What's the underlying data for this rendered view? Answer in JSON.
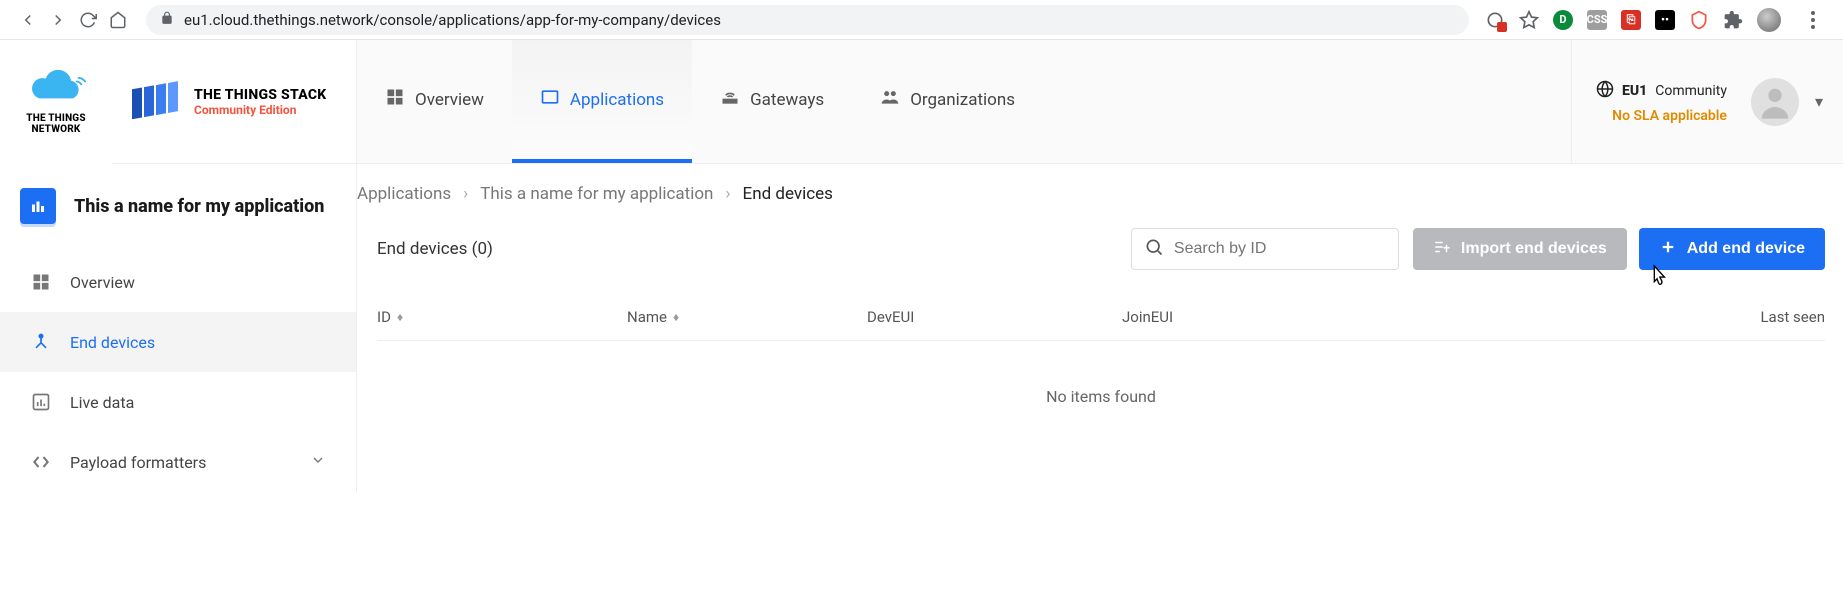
{
  "browser": {
    "url": "eu1.cloud.thethings.network/console/applications/app-for-my-company/devices"
  },
  "logo": {
    "line1": "THE THINGS",
    "line2": "NETWORK"
  },
  "stack": {
    "title": "THE THINGS STACK",
    "subtitle": "Community Edition"
  },
  "nav": {
    "overview": "Overview",
    "applications": "Applications",
    "gateways": "Gateways",
    "organizations": "Organizations"
  },
  "region": {
    "code": "EU1",
    "label": "Community",
    "sla": "No SLA applicable"
  },
  "sidebar": {
    "app_name": "This a name for my application",
    "overview": "Overview",
    "end_devices": "End devices",
    "live_data": "Live data",
    "payload_formatters": "Payload formatters"
  },
  "breadcrumbs": {
    "a": "Applications",
    "b": "This a name for my application",
    "c": "End devices"
  },
  "toolbar": {
    "title": "End devices (0)",
    "search_placeholder": "Search by ID",
    "import_label": "Import end devices",
    "add_label": "Add end device"
  },
  "table": {
    "id": "ID",
    "name": "Name",
    "deveui": "DevEUI",
    "joineui": "JoinEUI",
    "last_seen": "Last seen",
    "empty": "No items found"
  }
}
